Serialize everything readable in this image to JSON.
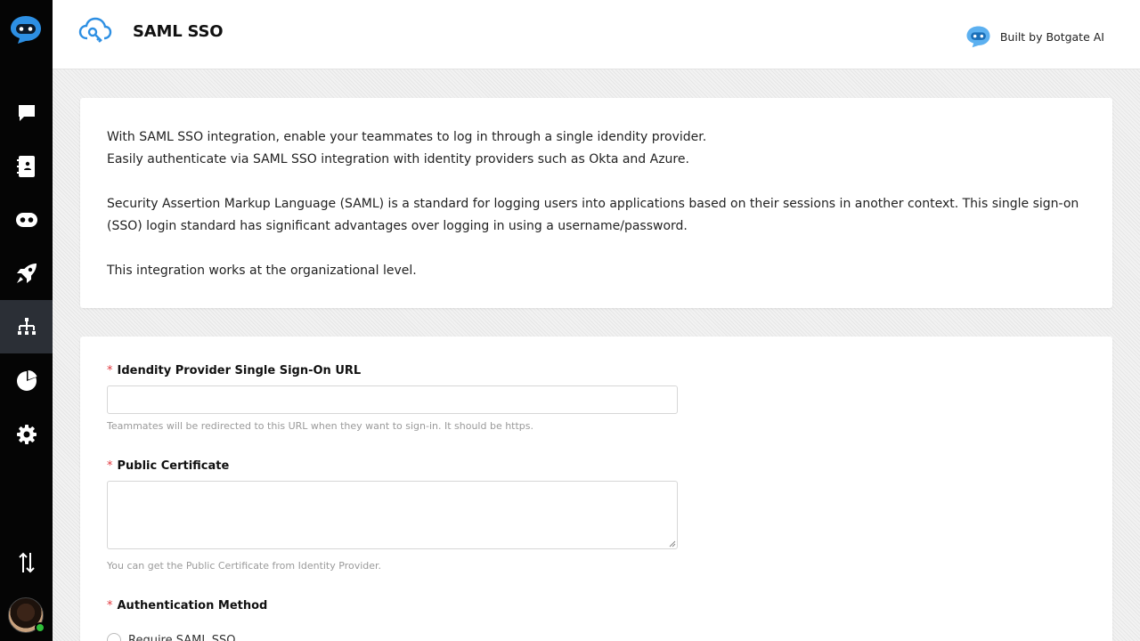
{
  "header": {
    "title": "SAML SSO",
    "built_by": "Built by Botgate AI"
  },
  "sidebar": {
    "items": [
      {
        "name": "conversations",
        "icon": "chat-icon"
      },
      {
        "name": "contacts",
        "icon": "contact-book-icon"
      },
      {
        "name": "bots",
        "icon": "bot-icon"
      },
      {
        "name": "campaigns",
        "icon": "rocket-icon"
      },
      {
        "name": "integrations",
        "icon": "hierarchy-icon",
        "active": true
      },
      {
        "name": "reports",
        "icon": "pie-chart-icon"
      },
      {
        "name": "settings",
        "icon": "gear-icon"
      }
    ],
    "bottom": {
      "icon": "sort-arrows-icon"
    }
  },
  "intro": {
    "line1": "With SAML SSO integration, enable your teammates to log in through a single idendity provider.",
    "line2": "Easily authenticate via SAML SSO integration with identity providers such as Okta and Azure.",
    "para2": "Security Assertion Markup Language (SAML) is a standard for logging users into applications based on their sessions in another context. This single sign-on (SSO) login standard has significant advantages over logging in using a username/password.",
    "para3": "This integration works at the organizational level."
  },
  "form": {
    "sso_url": {
      "required_mark": "*",
      "label": "Idendity Provider Single Sign-On URL",
      "value": "",
      "help": "Teammates will be redirected to this URL when they want to sign-in. It should be https."
    },
    "certificate": {
      "required_mark": "*",
      "label": "Public Certificate",
      "value": "",
      "help": "You can get the Public Certificate from Identity Provider."
    },
    "auth_method": {
      "required_mark": "*",
      "label": "Authentication Method",
      "options": [
        "Require SAML SSO"
      ]
    }
  },
  "colors": {
    "sidebar_bg": "#050505",
    "sidebar_active": "#2b2f36",
    "brand_blue": "#2d8fe3",
    "required_red": "#e0383e"
  }
}
